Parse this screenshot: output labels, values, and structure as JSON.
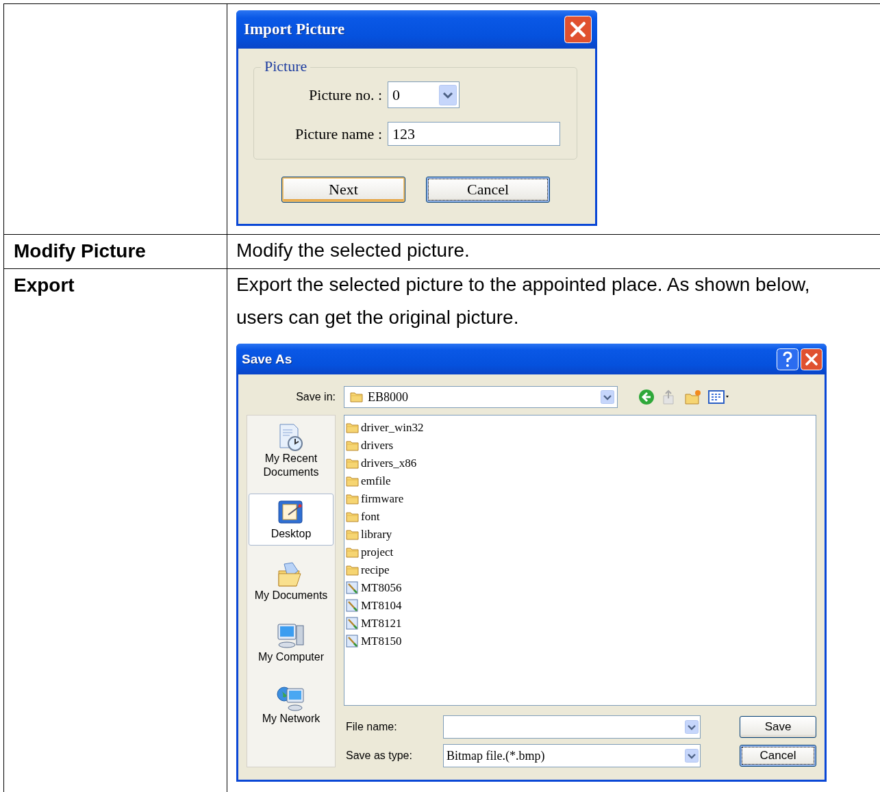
{
  "table": {
    "rows": [
      {
        "kind": "import_dialog"
      },
      {
        "label": "Modify Picture",
        "description": "Modify the selected picture."
      },
      {
        "label": "Export",
        "description": "Export the selected picture to the appointed place. As shown below, users can get the original picture.",
        "kind": "save_dialog"
      }
    ]
  },
  "import_dialog": {
    "title": "Import Picture",
    "group": "Picture",
    "fields": [
      {
        "kind": "combo",
        "label": "Picture no. :",
        "value": "0"
      },
      {
        "kind": "text",
        "label": "Picture name :",
        "value": "123"
      }
    ],
    "buttons": [
      {
        "label": "Next",
        "default": true,
        "focused": false
      },
      {
        "label": "Cancel",
        "default": false,
        "focused": true
      }
    ]
  },
  "save_dialog": {
    "title": "Save As",
    "save_in": {
      "label": "Save in:",
      "value": "EB8000"
    },
    "places": [
      {
        "label": "My Recent Documents",
        "kind": "recent",
        "selected": false
      },
      {
        "label": "Desktop",
        "kind": "desktop",
        "selected": true
      },
      {
        "label": "My Documents",
        "kind": "documents",
        "selected": false
      },
      {
        "label": "My Computer",
        "kind": "computer",
        "selected": false
      },
      {
        "label": "My Network",
        "kind": "network",
        "selected": false
      }
    ],
    "files": [
      {
        "name": "driver_win32",
        "kind": "folder"
      },
      {
        "name": "drivers",
        "kind": "folder"
      },
      {
        "name": "drivers_x86",
        "kind": "folder"
      },
      {
        "name": "emfile",
        "kind": "folder"
      },
      {
        "name": "firmware",
        "kind": "folder"
      },
      {
        "name": "font",
        "kind": "folder"
      },
      {
        "name": "library",
        "kind": "folder"
      },
      {
        "name": "project",
        "kind": "folder"
      },
      {
        "name": "recipe",
        "kind": "folder"
      },
      {
        "name": "MT8056",
        "kind": "image"
      },
      {
        "name": "MT8104",
        "kind": "image"
      },
      {
        "name": "MT8121",
        "kind": "image"
      },
      {
        "name": "MT8150",
        "kind": "image"
      }
    ],
    "file_name": {
      "label": "File name:"
    },
    "save_as_type": {
      "label": "Save as type:",
      "value": "Bitmap file.(*.bmp)"
    },
    "buttons": [
      {
        "label": "Save",
        "focused": false
      },
      {
        "label": "Cancel",
        "focused": true
      }
    ]
  }
}
